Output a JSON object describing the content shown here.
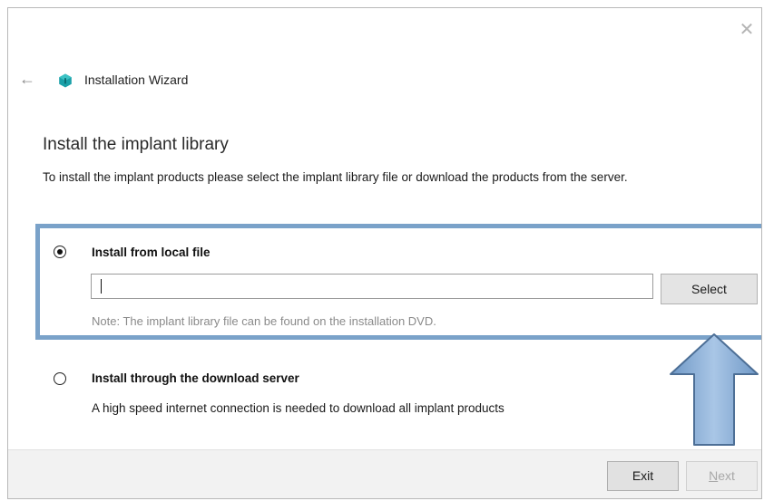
{
  "window": {
    "title": "Installation Wizard",
    "back_icon": "arrow-left-icon",
    "close_icon": "close-icon",
    "logo_icon": "hexagon-logo-icon"
  },
  "page": {
    "heading": "Install the implant library",
    "description": "To install the implant products please select the implant library file or download the products from the server."
  },
  "options": {
    "local": {
      "label": "Install from local file",
      "selected": true,
      "file_value": "",
      "select_label": "Select",
      "note": "Note: The implant library file can be found on the installation DVD."
    },
    "server": {
      "label": "Install through the download server",
      "selected": false,
      "help": "A high speed internet connection is needed to download all implant products"
    }
  },
  "footer": {
    "exit_label": "Exit",
    "next_label_mnemonic": "N",
    "next_label_rest": "ext",
    "next_enabled": false
  },
  "colors": {
    "highlight": "#7aa2c9",
    "arrow_fill": "#8fb3dc",
    "logo": "#1aa0a8"
  }
}
